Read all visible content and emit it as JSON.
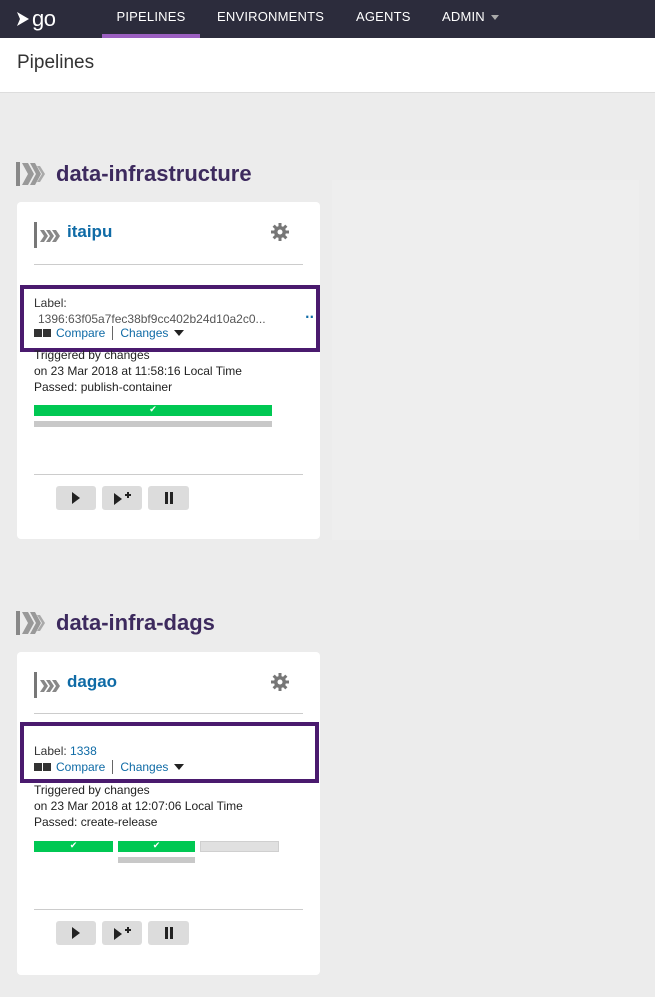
{
  "nav": {
    "logo_text": "go",
    "items": [
      "PIPELINES",
      "ENVIRONMENTS",
      "AGENTS",
      "ADMIN"
    ]
  },
  "page": {
    "title": "Pipelines"
  },
  "groups": [
    {
      "name": "data-infrastructure",
      "pipeline": {
        "name": "itaipu",
        "label_key": "Label:",
        "label_value": "1396:63f05a7fec38bf9cc402b24d10a2c0...",
        "ellipsis": "··",
        "compare": "Compare",
        "changes": "Changes",
        "triggered": "Triggered by changes",
        "time": "on 23 Mar 2018 at 11:58:16 Local Time",
        "passed": "Passed: publish-container"
      }
    },
    {
      "name": "data-infra-dags",
      "pipeline": {
        "name": "dagao",
        "label_key": "Label:",
        "label_value": "1338",
        "compare": "Compare",
        "changes": "Changes",
        "triggered": "Triggered by changes",
        "time": "on 23 Mar 2018 at 12:07:06 Local Time",
        "passed": "Passed: create-release"
      }
    }
  ],
  "colors": {
    "passed": "#00c853",
    "highlight": "#4a1a6e",
    "link": "#0f6ba6",
    "header": "#2c2c3c"
  },
  "icons": [
    "go-logo-icon",
    "pipeline-group-icon",
    "pipeline-icon",
    "gear-icon",
    "play-icon",
    "play-with-options-icon",
    "pause-icon",
    "check-icon"
  ]
}
